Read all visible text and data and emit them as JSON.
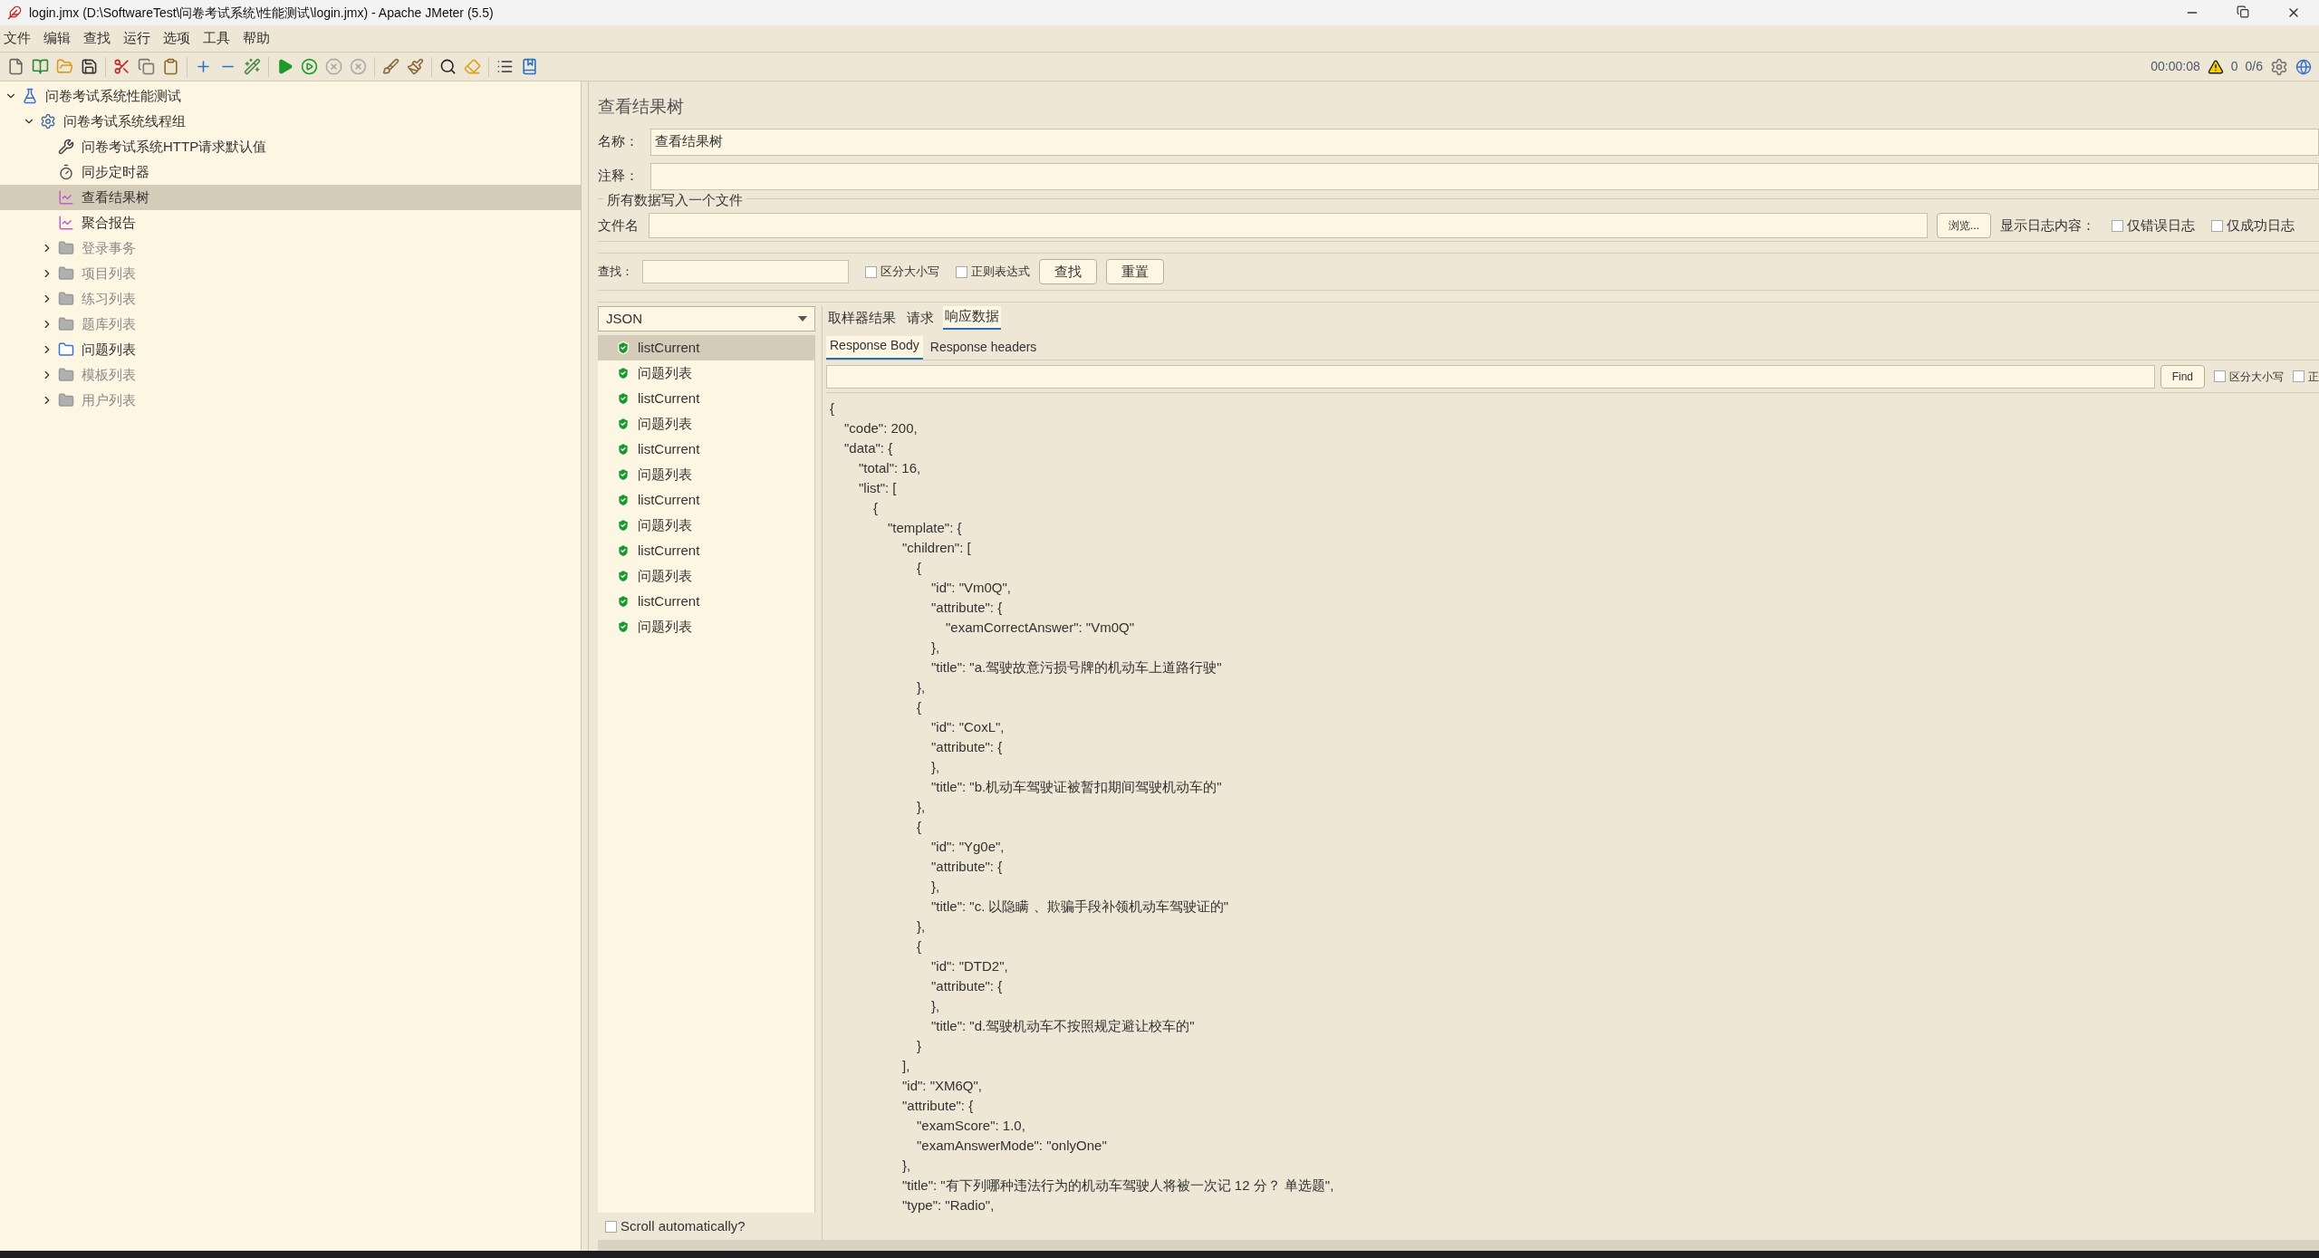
{
  "window": {
    "title": "login.jmx (D:\\SoftwareTest\\问卷考试系统\\性能测试\\login.jmx) - Apache JMeter (5.5)"
  },
  "menu": [
    "文件",
    "编辑",
    "查找",
    "运行",
    "选项",
    "工具",
    "帮助"
  ],
  "status": {
    "elapsed": "00:00:08",
    "warnings": "0",
    "threads": "0/6"
  },
  "tree": [
    {
      "label": "问卷考试系统性能测试",
      "kind": "plan",
      "expanded": true,
      "selected": false,
      "disabled": false,
      "children": [
        {
          "label": "问卷考试系统线程组",
          "kind": "thread-group",
          "expanded": true,
          "selected": false,
          "disabled": false,
          "children": [
            {
              "label": "问卷考试系统HTTP请求默认值",
              "kind": "config",
              "selected": false,
              "disabled": false
            },
            {
              "label": "同步定时器",
              "kind": "timer",
              "selected": false,
              "disabled": false
            },
            {
              "label": "查看结果树",
              "kind": "listener",
              "selected": true,
              "disabled": false
            },
            {
              "label": "聚合报告",
              "kind": "listener",
              "selected": false,
              "disabled": false
            },
            {
              "label": "登录事务",
              "kind": "controller",
              "expanded": false,
              "selected": false,
              "disabled": true
            },
            {
              "label": "项目列表",
              "kind": "controller",
              "expanded": false,
              "selected": false,
              "disabled": true
            },
            {
              "label": "练习列表",
              "kind": "controller",
              "expanded": false,
              "selected": false,
              "disabled": true
            },
            {
              "label": "题库列表",
              "kind": "controller",
              "expanded": false,
              "selected": false,
              "disabled": true
            },
            {
              "label": "问题列表",
              "kind": "controller",
              "expanded": false,
              "selected": false,
              "disabled": false
            },
            {
              "label": "模板列表",
              "kind": "controller",
              "expanded": false,
              "selected": false,
              "disabled": true
            },
            {
              "label": "用户列表",
              "kind": "controller",
              "expanded": false,
              "selected": false,
              "disabled": true
            }
          ]
        }
      ]
    }
  ],
  "panel": {
    "title": "查看结果树",
    "name_label": "名称：",
    "name_value": "查看结果树",
    "comment_label": "注释：",
    "file_group": {
      "title": "所有数据写入一个文件",
      "file_label": "文件名",
      "browse": "浏览...",
      "log_label": "显示日志内容：",
      "options": [
        {
          "label": "仅错误日志",
          "checked": false
        },
        {
          "label": "仅成功日志",
          "checked": false
        }
      ]
    },
    "search": {
      "label": "查找：",
      "options": [
        {
          "label": "区分大小写",
          "checked": false
        },
        {
          "label": "正则表达式",
          "checked": false
        }
      ],
      "buttons": [
        "查找",
        "重置"
      ]
    },
    "renderer": "JSON",
    "samples": [
      {
        "label": "listCurrent",
        "selected": true,
        "success": true
      },
      {
        "label": "问题列表",
        "selected": false,
        "success": true
      },
      {
        "label": "listCurrent",
        "selected": false,
        "success": true
      },
      {
        "label": "问题列表",
        "selected": false,
        "success": true
      },
      {
        "label": "listCurrent",
        "selected": false,
        "success": true
      },
      {
        "label": "问题列表",
        "selected": false,
        "success": true
      },
      {
        "label": "listCurrent",
        "selected": false,
        "success": true
      },
      {
        "label": "问题列表",
        "selected": false,
        "success": true
      },
      {
        "label": "listCurrent",
        "selected": false,
        "success": true
      },
      {
        "label": "问题列表",
        "selected": false,
        "success": true
      },
      {
        "label": "listCurrent",
        "selected": false,
        "success": true
      },
      {
        "label": "问题列表",
        "selected": false,
        "success": true
      }
    ],
    "scroll_auto": {
      "label": "Scroll automatically?",
      "checked": false
    },
    "tabs": [
      {
        "label": "取样器结果",
        "selected": false
      },
      {
        "label": "请求",
        "selected": false
      },
      {
        "label": "响应数据",
        "selected": true
      }
    ],
    "subtabs": [
      {
        "label": "Response Body",
        "selected": true
      },
      {
        "label": "Response headers",
        "selected": false
      }
    ],
    "find": {
      "button": "Find",
      "options": [
        {
          "label": "区分大小写",
          "checked": false
        },
        {
          "label": "正",
          "checked": false
        }
      ]
    },
    "body_lines": [
      "{",
      "\"code\": 200,",
      "\"data\": {",
      "\"total\": 16,",
      "\"list\": [",
      "{",
      "\"template\": {",
      "\"children\": [",
      "{",
      "\"id\": \"Vm0Q\",",
      "\"attribute\": {",
      "\"examCorrectAnswer\": \"Vm0Q\"",
      "},",
      "\"title\": \"a.驾驶故意污损号牌的机动车上道路行驶\"",
      "},",
      "{",
      "\"id\": \"CoxL\",",
      "\"attribute\": {",
      "},",
      "\"title\": \"b.机动车驾驶证被暂扣期间驾驶机动车的\"",
      "},",
      "{",
      "\"id\": \"Yg0e\",",
      "\"attribute\": {",
      "},",
      "\"title\": \"c. 以隐瞒 、欺骗手段补领机动车驾驶证的\"",
      "},",
      "{",
      "\"id\": \"DTD2\",",
      "\"attribute\": {",
      "},",
      "\"title\": \"d.驾驶机动车不按照规定避让校车的\"",
      "}",
      "],",
      "\"id\": \"XM6Q\",",
      "\"attribute\": {",
      "\"examScore\": 1.0,",
      "\"examAnswerMode\": \"onlyOne\"",
      "},",
      "\"title\": \"有下列哪种违法行为的机动车驾驶人将被一次记 12 分？ 单选题\",",
      "\"type\": \"Radio\","
    ]
  }
}
